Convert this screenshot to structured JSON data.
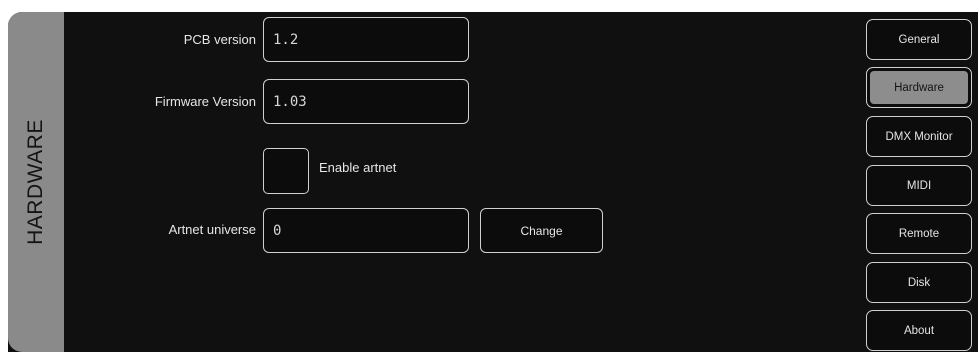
{
  "side_tab": {
    "label": "HARDWARE"
  },
  "form": {
    "pcb_version": {
      "label": "PCB version",
      "value": "1.2"
    },
    "firmware_version": {
      "label": "Firmware Version",
      "value": "1.03"
    },
    "enable_artnet": {
      "label": "Enable artnet",
      "checked": false
    },
    "artnet_universe": {
      "label": "Artnet universe",
      "value": "0",
      "button": "Change"
    }
  },
  "nav": {
    "items": [
      {
        "label": "General"
      },
      {
        "label": "Hardware"
      },
      {
        "label": "DMX Monitor"
      },
      {
        "label": "MIDI"
      },
      {
        "label": "Remote"
      },
      {
        "label": "Disk"
      },
      {
        "label": "About"
      }
    ],
    "active": "Hardware"
  },
  "colors": {
    "background": "#101010",
    "side_tab": "#8a8a8a",
    "active_nav": "#8d8d8d",
    "border": "#d0d0d0"
  }
}
